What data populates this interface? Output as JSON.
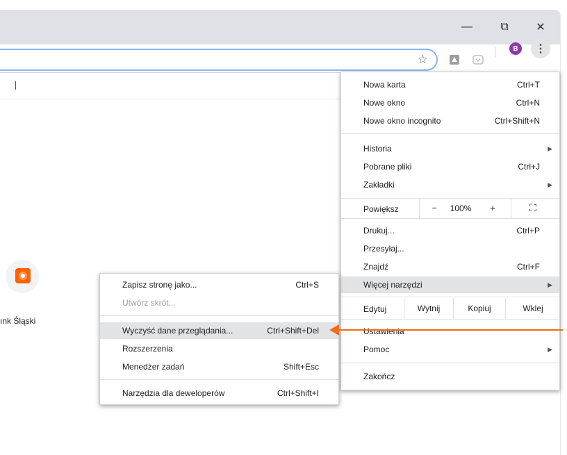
{
  "window": {
    "minimize": "—",
    "restore": "⧉",
    "close": "✕"
  },
  "toolbar": {
    "star": "☆",
    "avatar_letter": "B",
    "menu_icon": "⋮",
    "accent": "#8ab4f8"
  },
  "page": {
    "shortcut_label": "ınk Śląski",
    "logo_glyph": "🦁"
  },
  "menu": {
    "items": [
      {
        "label": "Nowa karta",
        "shortcut": "Ctrl+T"
      },
      {
        "label": "Nowe okno",
        "shortcut": "Ctrl+N"
      },
      {
        "label": "Nowe okno incognito",
        "shortcut": "Ctrl+Shift+N"
      },
      {
        "label": "Historia",
        "shortcut": ""
      },
      {
        "label": "Pobrane pliki",
        "shortcut": "Ctrl+J"
      },
      {
        "label": "Zakładki",
        "shortcut": ""
      },
      {
        "label": "Drukuj...",
        "shortcut": "Ctrl+P"
      },
      {
        "label": "Przesyłaj...",
        "shortcut": ""
      },
      {
        "label": "Znajdź",
        "shortcut": "Ctrl+F"
      },
      {
        "label": "Więcej narzędzi",
        "shortcut": ""
      },
      {
        "label": "Ustawienia",
        "shortcut": ""
      },
      {
        "label": "Pomoc",
        "shortcut": ""
      },
      {
        "label": "Zakończ",
        "shortcut": ""
      }
    ],
    "zoom": {
      "label": "Powiększ",
      "minus": "−",
      "value": "100%",
      "plus": "+",
      "fullscreen": "⛶"
    },
    "edit": {
      "label": "Edytuj",
      "cut": "Wytnij",
      "copy": "Kopiuj",
      "paste": "Wklej"
    }
  },
  "submenu": {
    "items": [
      {
        "label": "Zapisz stronę jako...",
        "shortcut": "Ctrl+S"
      },
      {
        "label": "Utwórz skrót...",
        "shortcut": ""
      },
      {
        "label": "Wyczyść dane przeglądania...",
        "shortcut": "Ctrl+Shift+Del"
      },
      {
        "label": "Rozszerzenia",
        "shortcut": ""
      },
      {
        "label": "Menedżer zadań",
        "shortcut": "Shift+Esc"
      },
      {
        "label": "Narzędzia dla deweloperów",
        "shortcut": "Ctrl+Shift+I"
      }
    ]
  },
  "colors": {
    "highlight": "#e2e3e5",
    "arrow": "#ef6c1a",
    "avatar": "#8e3aa5"
  }
}
